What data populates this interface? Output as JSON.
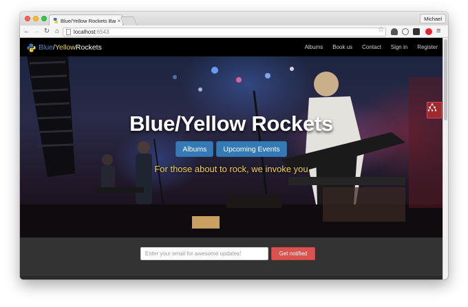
{
  "browser": {
    "tab_title": "Blue/Yellow Rockets Band",
    "tab_close": "×",
    "profile_name": "Michael",
    "url_host": "localhost",
    "url_port": ":6543",
    "icons": {
      "back": "back-arrow-icon",
      "forward": "forward-arrow-icon",
      "reload": "reload-icon",
      "home": "home-icon",
      "bookmark": "star-icon",
      "menu": "hamburger-menu-icon"
    }
  },
  "navbar": {
    "brand_blue": "Blue",
    "brand_sep": " / ",
    "brand_yellow": "Yellow",
    "brand_rest": " Rockets",
    "links": [
      "Albums",
      "Book us",
      "Contact",
      "Sign in",
      "Register"
    ]
  },
  "hero": {
    "title": "Blue/Yellow Rockets",
    "buttons": [
      "Albums",
      "Upcoming Events"
    ],
    "tagline": "For those about to rock, we invoke you"
  },
  "signup": {
    "email_placeholder": "Enter your email for awesome updates!",
    "button_label": "Get notified"
  },
  "colors": {
    "brand_blue": "#4d8fd1",
    "brand_yellow": "#f2d24b",
    "primary_button": "#337ab7",
    "danger_button": "#d9534f",
    "navbar_bg": "#000000",
    "footer_bg": "#333333"
  }
}
